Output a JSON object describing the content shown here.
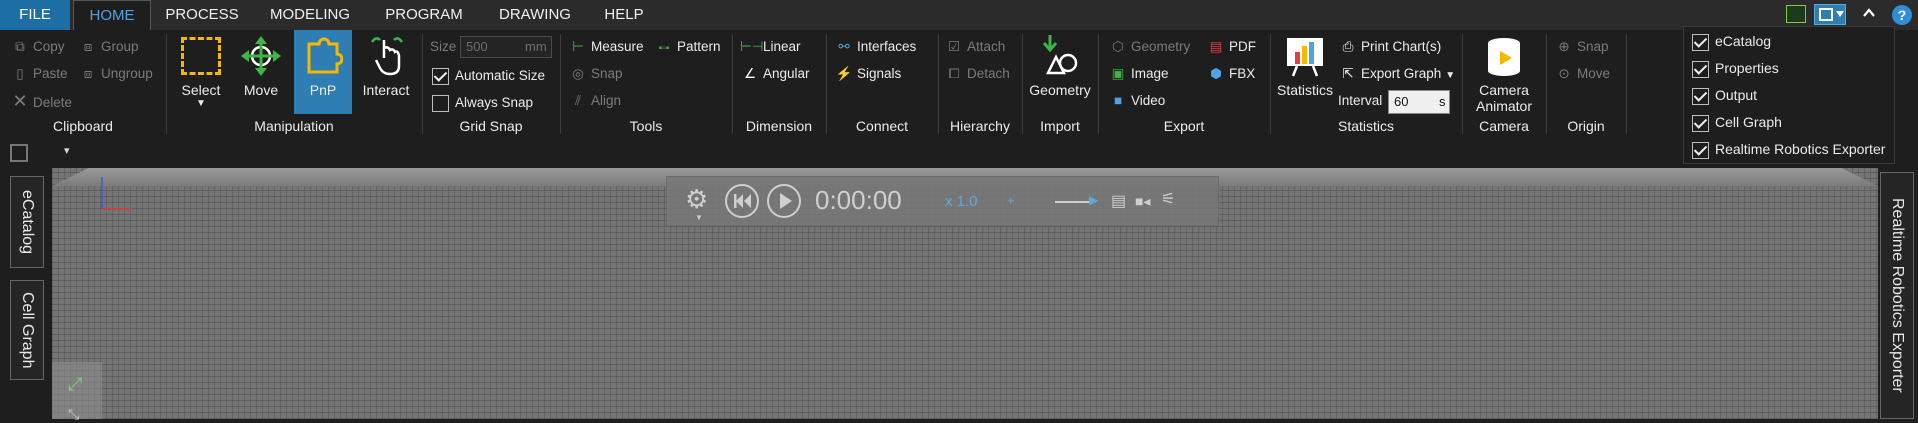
{
  "menu": {
    "tabs": [
      "FILE",
      "HOME",
      "PROCESS",
      "MODELING",
      "PROGRAM",
      "DRAWING",
      "HELP"
    ],
    "active": "HOME"
  },
  "ribbon": {
    "clipboard": {
      "label": "Clipboard",
      "copy": "Copy",
      "paste": "Paste",
      "delete": "Delete",
      "group": "Group",
      "ungroup": "Ungroup"
    },
    "manipulation": {
      "label": "Manipulation",
      "select": "Select",
      "move": "Move",
      "pnp": "PnP",
      "interact": "Interact"
    },
    "grid_snap": {
      "label": "Grid Snap",
      "size_label": "Size",
      "size_placeholder": "500",
      "size_unit": "mm",
      "automatic_size": "Automatic Size",
      "always_snap": "Always Snap",
      "automatic_size_checked": true,
      "always_snap_checked": false
    },
    "tools": {
      "label": "Tools",
      "measure": "Measure",
      "pattern": "Pattern",
      "snap": "Snap",
      "align": "Align"
    },
    "dimension": {
      "label": "Dimension",
      "linear": "Linear",
      "angular": "Angular"
    },
    "connect": {
      "label": "Connect",
      "interfaces": "Interfaces",
      "signals": "Signals"
    },
    "hierarchy": {
      "label": "Hierarchy",
      "attach": "Attach",
      "detach": "Detach"
    },
    "import": {
      "label": "Import",
      "geometry": "Geometry"
    },
    "export": {
      "label": "Export",
      "geometry": "Geometry",
      "image": "Image",
      "video": "Video",
      "pdf": "PDF",
      "fbx": "FBX"
    },
    "statistics": {
      "label": "Statistics",
      "statistics": "Statistics",
      "print_charts": "Print Chart(s)",
      "export_graph": "Export Graph",
      "interval_label": "Interval",
      "interval_value": "60",
      "interval_unit": "s"
    },
    "camera": {
      "label": "Camera",
      "camera_animator_1": "Camera",
      "camera_animator_2": "Animator"
    },
    "origin": {
      "label": "Origin",
      "snap": "Snap",
      "move": "Move"
    }
  },
  "panel_menu": {
    "items": [
      {
        "label": "eCatalog",
        "checked": true
      },
      {
        "label": "Properties",
        "checked": true
      },
      {
        "label": "Output",
        "checked": true
      },
      {
        "label": "Cell Graph",
        "checked": true
      },
      {
        "label": "Realtime Robotics Exporter",
        "checked": true
      }
    ]
  },
  "side_tabs": {
    "left": [
      "eCatalog",
      "Cell Graph"
    ],
    "right": [
      "Realtime Robotics Exporter"
    ]
  },
  "playback": {
    "time": "0:00:00",
    "speed": "x 1.0"
  },
  "help_glyph": "?",
  "colors": {
    "accent": "#1c6ea4",
    "active_tab_text": "#4fa3e0",
    "pnp_bg": "#2e7db3"
  }
}
